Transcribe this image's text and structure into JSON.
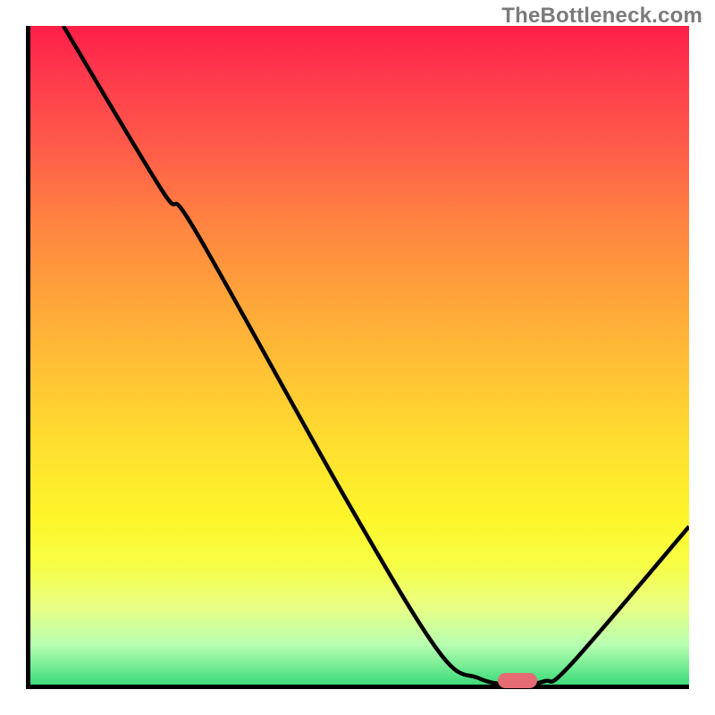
{
  "watermark": "TheBottleneck.com",
  "chart_data": {
    "type": "line",
    "title": "",
    "xlabel": "",
    "ylabel": "",
    "xlim": [
      0,
      100
    ],
    "ylim": [
      0,
      100
    ],
    "series": [
      {
        "name": "curve",
        "points": [
          {
            "x": 5.0,
            "y": 100.0
          },
          {
            "x": 20.0,
            "y": 75.0
          },
          {
            "x": 25.0,
            "y": 69.0
          },
          {
            "x": 48.0,
            "y": 28.0
          },
          {
            "x": 62.0,
            "y": 5.0
          },
          {
            "x": 68.0,
            "y": 1.0
          },
          {
            "x": 73.0,
            "y": 0.0
          },
          {
            "x": 78.0,
            "y": 0.5
          },
          {
            "x": 82.0,
            "y": 3.0
          },
          {
            "x": 100.0,
            "y": 24.0
          }
        ]
      }
    ],
    "marker": {
      "x_center": 74,
      "y": 0,
      "width_pct": 6,
      "color": "#e76b73"
    },
    "gradient_colors": {
      "top": "#ff1e4a",
      "mid_upper": "#ff8440",
      "mid": "#ffe62e",
      "mid_lower": "#eaff82",
      "bottom": "#3cdb7a"
    }
  }
}
